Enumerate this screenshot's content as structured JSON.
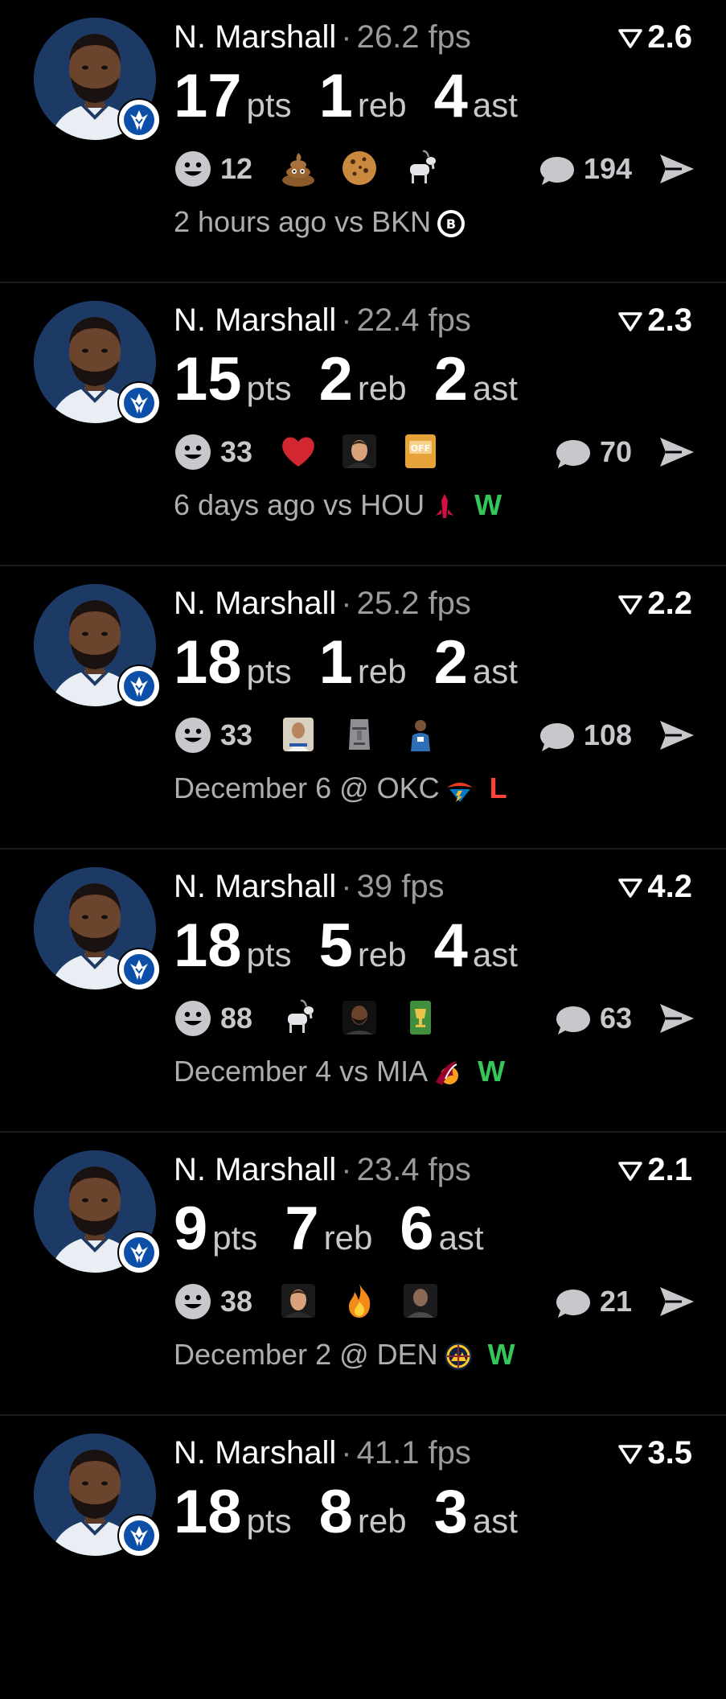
{
  "feed": [
    {
      "name": "N. Marshall",
      "fps": "26.2 fps",
      "rating": "2.6",
      "pts": "17",
      "reb": "1",
      "ast": "4",
      "pts_label": "pts",
      "reb_label": "reb",
      "ast_label": "ast",
      "reactions_count": "12",
      "comments_count": "194",
      "emojis": [
        "poop-emoji",
        "cookie-emoji",
        "goat-emoji"
      ],
      "when": "2 hours ago vs BKN",
      "opponent_logo": "nets-logo",
      "result": ""
    },
    {
      "name": "N. Marshall",
      "fps": "22.4 fps",
      "rating": "2.3",
      "pts": "15",
      "reb": "2",
      "ast": "2",
      "pts_label": "pts",
      "reb_label": "reb",
      "ast_label": "ast",
      "reactions_count": "33",
      "comments_count": "70",
      "emojis": [
        "heart-emoji",
        "player-face-emoji",
        "off-sign-emoji"
      ],
      "when": "6 days ago vs HOU",
      "opponent_logo": "rockets-logo",
      "result": "W"
    },
    {
      "name": "N. Marshall",
      "fps": "25.2 fps",
      "rating": "2.2",
      "pts": "18",
      "reb": "1",
      "ast": "2",
      "pts_label": "pts",
      "reb_label": "reb",
      "ast_label": "ast",
      "reactions_count": "33",
      "comments_count": "108",
      "emojis": [
        "player-card-emoji",
        "moai-emoji",
        "player-figure-emoji"
      ],
      "when": "December 6 @ OKC",
      "opponent_logo": "thunder-logo",
      "result": "L"
    },
    {
      "name": "N. Marshall",
      "fps": "39 fps",
      "rating": "4.2",
      "pts": "18",
      "reb": "5",
      "ast": "4",
      "pts_label": "pts",
      "reb_label": "reb",
      "ast_label": "ast",
      "reactions_count": "88",
      "comments_count": "63",
      "emojis": [
        "goat-emoji",
        "bearded-player-emoji",
        "trophy-card-emoji"
      ],
      "when": "December 4 vs MIA",
      "opponent_logo": "heat-logo",
      "result": "W"
    },
    {
      "name": "N. Marshall",
      "fps": "23.4 fps",
      "rating": "2.1",
      "pts": "9",
      "reb": "7",
      "ast": "6",
      "pts_label": "pts",
      "reb_label": "reb",
      "ast_label": "ast",
      "reactions_count": "38",
      "comments_count": "21",
      "emojis": [
        "player-face-emoji",
        "fire-emoji",
        "bald-player-emoji"
      ],
      "when": "December 2 @ DEN",
      "opponent_logo": "nuggets-logo",
      "result": "W"
    },
    {
      "name": "N. Marshall",
      "fps": "41.1 fps",
      "rating": "3.5",
      "pts": "18",
      "reb": "8",
      "ast": "3",
      "pts_label": "pts",
      "reb_label": "reb",
      "ast_label": "ast",
      "reactions_count": "",
      "comments_count": "",
      "emojis": [],
      "when": "",
      "opponent_logo": "",
      "result": ""
    }
  ],
  "colors": {
    "win": "#34c759",
    "loss": "#ff453a",
    "avatar_bg": "#1d3a66"
  },
  "icons": {
    "rating": "triangle-down-icon",
    "reactions": "smile-icon",
    "comments": "comment-bubble-icon",
    "share": "send-icon",
    "team": "mavericks-logo"
  }
}
